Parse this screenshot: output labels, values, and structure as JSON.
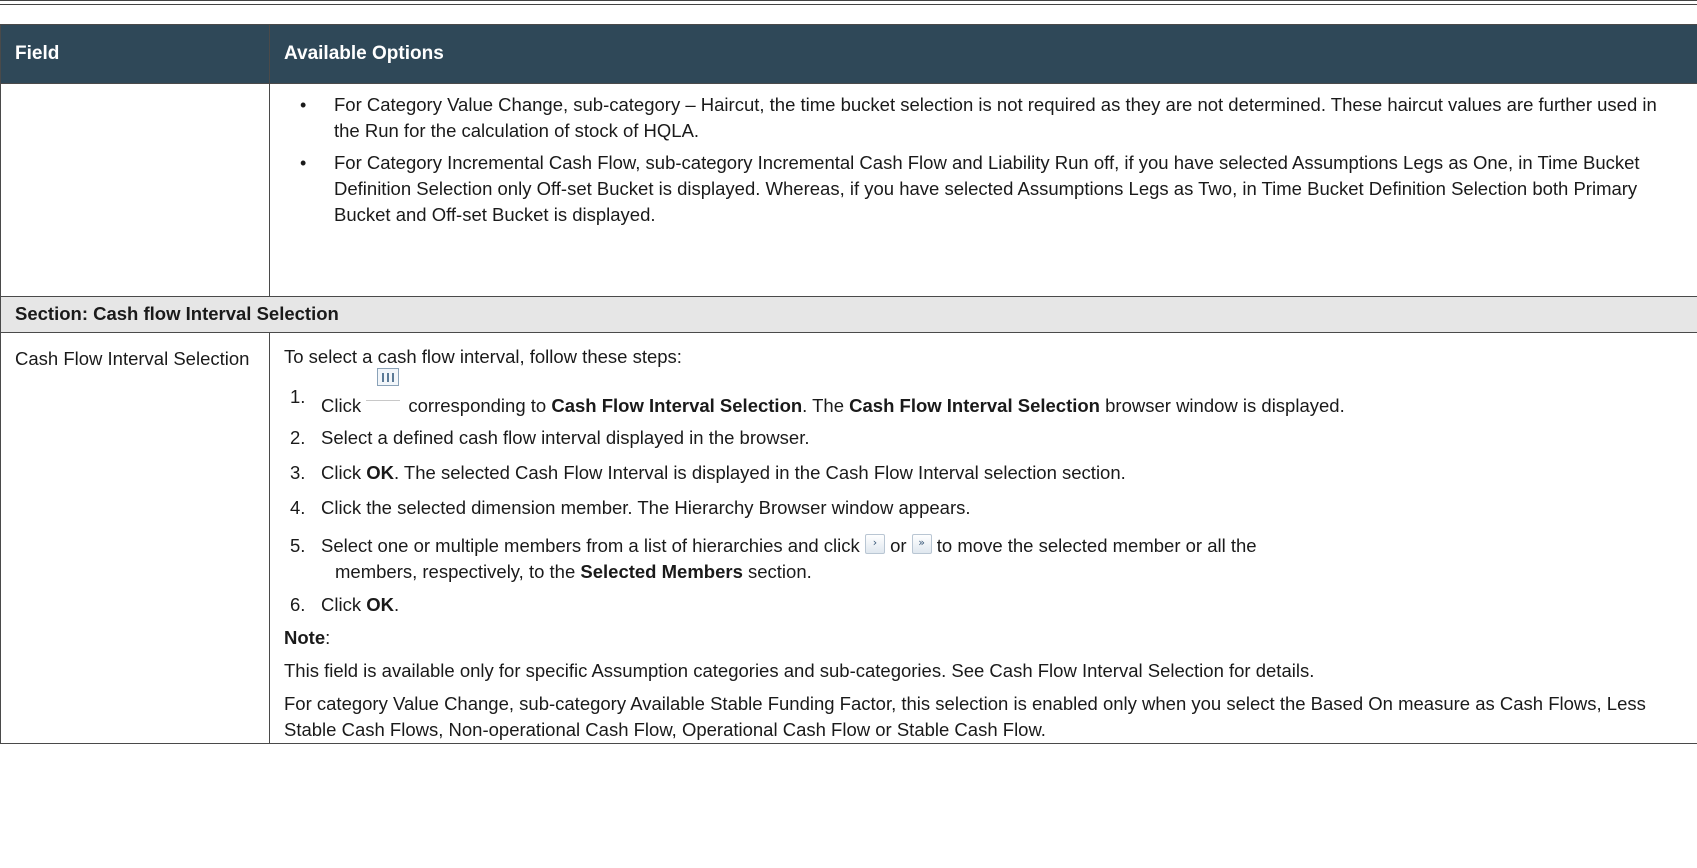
{
  "table": {
    "header_field": "Field",
    "header_options": "Available Options"
  },
  "continuation_bullets": [
    "For Category Value Change, sub-category – Haircut, the time bucket selection is not required as they are not determined. These haircut values are further used in the Run for the calculation of stock of HQLA.",
    "For Category Incremental Cash Flow, sub-category Incremental Cash Flow and Liability Run off, if you have selected Assumptions Legs as One, in Time Bucket Definition Selection only Off-set Bucket is displayed. Whereas, if you have selected Assumptions Legs as Two, in Time Bucket Definition Selection both Primary Bucket and Off-set Bucket is displayed."
  ],
  "section_title": "Section: Cash flow Interval Selection",
  "cash_flow": {
    "field_label": "Cash Flow Interval Selection",
    "intro": "To select a cash flow interval, follow these steps:",
    "step1": {
      "num": "1.",
      "pre": "Click",
      "mid1": "corresponding to",
      "bold1": "Cash Flow Interval Selection",
      "mid2": ". The",
      "bold2": "Cash Flow Interval Selection",
      "post": "browser window is displayed.",
      "icon": "hierarchy-browser-icon"
    },
    "step2": {
      "num": "2.",
      "text": "Select a defined cash flow interval displayed in the browser."
    },
    "step3": {
      "num": "3.",
      "pre": "Click",
      "bold": "OK",
      "post": ". The selected Cash Flow Interval is displayed in the Cash Flow Interval selection section."
    },
    "step4": {
      "num": "4.",
      "text": "Click the selected dimension member. The Hierarchy Browser window appears."
    },
    "step5": {
      "num": "5.",
      "pre": "Select one or multiple members from a list of hierarchies and click",
      "or": "or",
      "post1": "to move the selected member or all the",
      "post2": "members, respectively, to the",
      "bold": "Selected Members",
      "post3": "section.",
      "icon_single": "›",
      "icon_all": "»"
    },
    "step6": {
      "num": "6.",
      "pre": "Click",
      "bold": "OK",
      "post": "."
    },
    "note_label": "Note",
    "note_colon": ":",
    "note_text": "This field is available only for specific Assumption categories and sub-categories. See Cash Flow Interval Selection for details.",
    "extra_text": "For category Value Change, sub-category Available Stable Funding Factor, this selection is enabled only when you select the Based On measure as Cash Flows, Less Stable Cash Flows, Non-operational Cash Flow, Operational Cash Flow or Stable Cash Flow."
  },
  "colors": {
    "header_bg": "#2f4858",
    "section_bg": "#e6e6e6"
  }
}
